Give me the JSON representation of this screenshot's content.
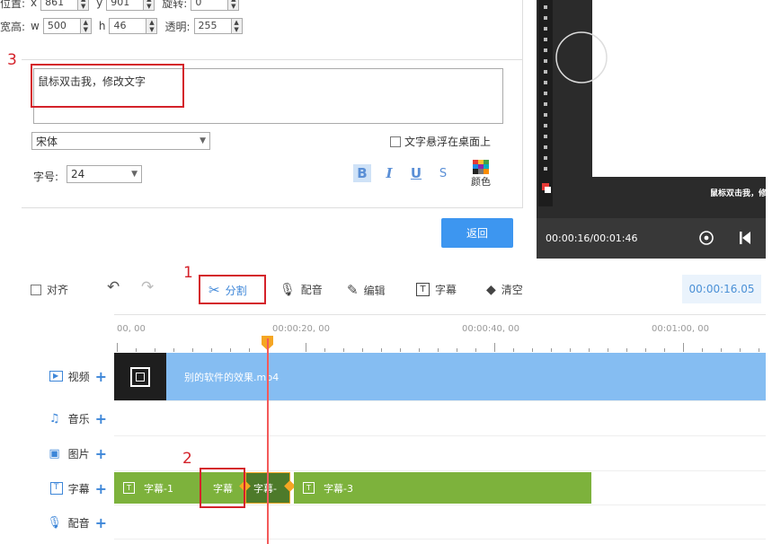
{
  "props": {
    "pos_label": "位置:",
    "x_label": "x",
    "x_value": "861",
    "y_label": "y",
    "y_value": "901",
    "rotate_label": "旋转:",
    "rotate_value": "0",
    "size_label": "宽高:",
    "w_label": "w",
    "w_value": "500",
    "h_label": "h",
    "h_value": "46",
    "opacity_label": "透明:",
    "opacity_value": "255"
  },
  "editor": {
    "text": "鼠标双击我，修改文字",
    "font": "宋体",
    "float_label": "文字悬浮在桌面上",
    "size_label": "字号:",
    "size_value": "24",
    "bold": "B",
    "italic": "I",
    "underline": "U",
    "strike": "S",
    "color_label": "颜色",
    "back_label": "返回"
  },
  "annotations": {
    "n1": "1",
    "n2": "2",
    "n3": "3"
  },
  "preview": {
    "time": "00:00:16/00:01:46",
    "caption": "鼠标双击我，修"
  },
  "toolbar": {
    "align": "对齐",
    "split": "分割",
    "dub": "配音",
    "edit": "编辑",
    "subtitle": "字幕",
    "clear": "清空",
    "current_time": "00:00:16.05"
  },
  "ruler": {
    "t0": "00, 00",
    "t20": "00:00:20, 00",
    "t40": "00:00:40, 00",
    "t60": "00:01:00, 00"
  },
  "tracks": {
    "video": "视频",
    "music": "音乐",
    "image": "图片",
    "subtitle": "字幕",
    "dub": "配音"
  },
  "clips": {
    "video": "别的软件的效果.mp4",
    "sub1": "字幕-1",
    "sub_split_a": "字幕",
    "sub_split_b": "字幕-",
    "sub3": "字幕-3"
  },
  "colors": {
    "accent": "#3d96f0",
    "video_clip": "#85bdf2",
    "subtitle_clip": "#7db23c",
    "subtitle_dark": "#4d7a2a",
    "annotation_red": "#d4222a",
    "playhead": "#f35a5a"
  }
}
